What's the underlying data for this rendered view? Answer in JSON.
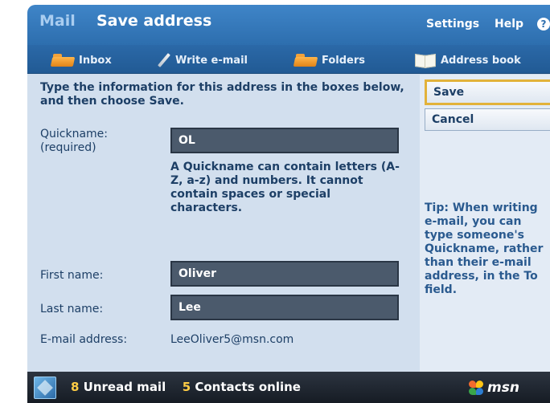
{
  "header": {
    "app_name": "Mail",
    "page_title": "Save address",
    "settings_label": "Settings",
    "help_label": "Help"
  },
  "nav": {
    "items": [
      {
        "label": "Inbox",
        "icon": "folder-icon"
      },
      {
        "label": "Write e-mail",
        "icon": "pen-icon"
      },
      {
        "label": "Folders",
        "icon": "folder-icon"
      },
      {
        "label": "Address book",
        "icon": "book-icon"
      }
    ]
  },
  "form": {
    "intro_text": "Type the information for this address in the boxes below, and then choose ",
    "intro_bold": "Save",
    "intro_end": ".",
    "quickname_label": "Quickname:",
    "quickname_required": "(required)",
    "quickname_value": "OL",
    "quickname_help": "A Quickname can contain letters (A-Z, a-z) and numbers. It cannot contain spaces or special characters.",
    "first_name_label": "First name:",
    "first_name_value": "Oliver",
    "last_name_label": "Last name:",
    "last_name_value": "Lee",
    "email_label": "E-mail address:",
    "email_value": "LeeOliver5@msn.com"
  },
  "side": {
    "save_label": "Save",
    "cancel_label": "Cancel",
    "tip_text": "Tip: When writing e-mail, you can type someone's Quickname, rather than their e-mail address, in the To field."
  },
  "footer": {
    "unread_count": "8",
    "unread_label": "Unread mail",
    "contacts_count": "5",
    "contacts_label": "Contacts online",
    "brand": "msn"
  },
  "colors": {
    "header_blue": "#3f85c8",
    "content_bg": "#d2dfee",
    "field_bg": "#4b5a6c",
    "save_highlight": "#e2b23a",
    "footer_bg": "#1f2630",
    "count_yellow": "#ffcd45"
  }
}
